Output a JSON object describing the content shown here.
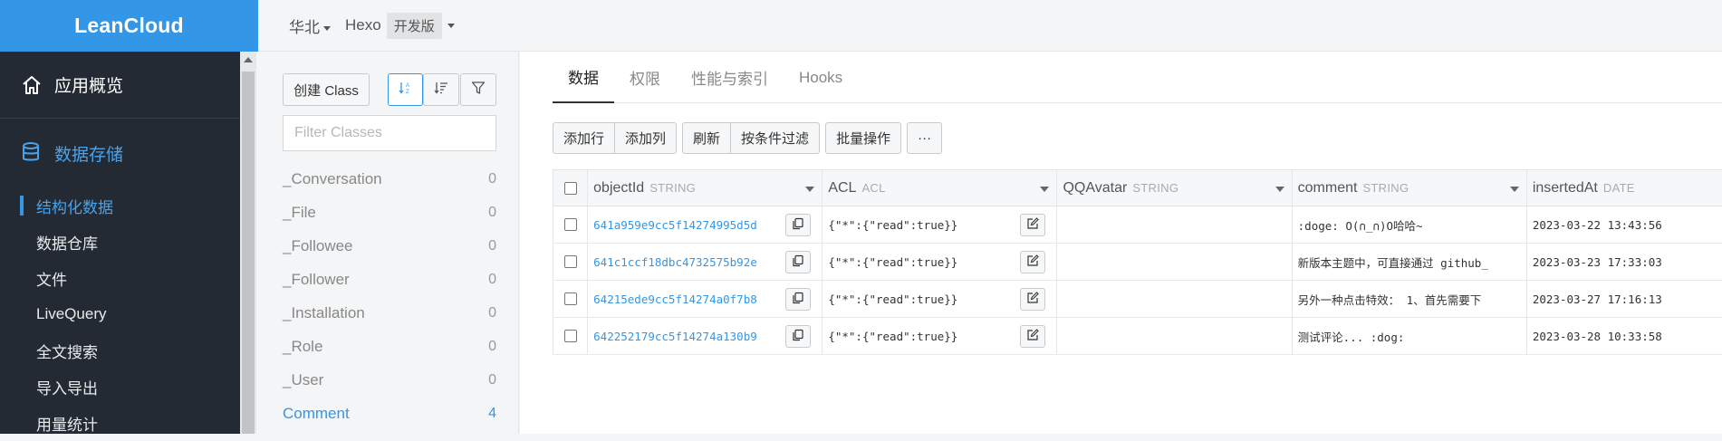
{
  "brand": "LeanCloud",
  "sidebar": {
    "overview": "应用概览",
    "storage": "数据存储",
    "items": [
      {
        "label": "结构化数据",
        "active": true
      },
      {
        "label": "数据仓库"
      },
      {
        "label": "文件"
      },
      {
        "label": "LiveQuery"
      },
      {
        "label": "全文搜索"
      },
      {
        "label": "导入导出"
      },
      {
        "label": "用量统计"
      }
    ]
  },
  "topbar": {
    "region": "华北",
    "app": "Hexo",
    "env": "开发版"
  },
  "classes": {
    "create_label": "创建 Class",
    "filter_placeholder": "Filter Classes",
    "items": [
      {
        "name": "_Conversation",
        "count": "0"
      },
      {
        "name": "_File",
        "count": "0"
      },
      {
        "name": "_Followee",
        "count": "0"
      },
      {
        "name": "_Follower",
        "count": "0"
      },
      {
        "name": "_Installation",
        "count": "0"
      },
      {
        "name": "_Role",
        "count": "0"
      },
      {
        "name": "_User",
        "count": "0"
      },
      {
        "name": "Comment",
        "count": "4",
        "active": true
      }
    ]
  },
  "tabs": [
    "数据",
    "权限",
    "性能与索引",
    "Hooks"
  ],
  "toolbar": {
    "add_row": "添加行",
    "add_col": "添加列",
    "refresh": "刷新",
    "filter": "按条件过滤",
    "batch": "批量操作",
    "more": "···"
  },
  "table": {
    "columns": [
      {
        "name": "objectId",
        "type": "STRING"
      },
      {
        "name": "ACL",
        "type": "ACL"
      },
      {
        "name": "QQAvatar",
        "type": "STRING"
      },
      {
        "name": "comment",
        "type": "STRING"
      },
      {
        "name": "insertedAt",
        "type": "DATE"
      }
    ],
    "rows": [
      {
        "objectId": "641a959e9cc5f14274995d5d",
        "acl": "{\"*\":{\"read\":true}}",
        "qq": "",
        "comment": ":doge: O(∩_∩)O哈哈~",
        "insertedAt": "2023-03-22 13:43:56"
      },
      {
        "objectId": "641c1ccf18dbc4732575b92e",
        "acl": "{\"*\":{\"read\":true}}",
        "qq": "",
        "comment": "新版本主题中，可直接通过 github_",
        "insertedAt": "2023-03-23 17:33:03"
      },
      {
        "objectId": "64215ede9cc5f14274a0f7b8",
        "acl": "{\"*\":{\"read\":true}}",
        "qq": "",
        "comment": "另外一种点击特效： 1、首先需要下",
        "insertedAt": "2023-03-27 17:16:13"
      },
      {
        "objectId": "642252179cc5f14274a130b9",
        "acl": "{\"*\":{\"read\":true}}",
        "qq": "",
        "comment": "测试评论... :dog:",
        "insertedAt": "2023-03-28 10:33:58"
      }
    ]
  },
  "colors": {
    "accent": "#3496e6",
    "sidebar": "#232a33"
  }
}
